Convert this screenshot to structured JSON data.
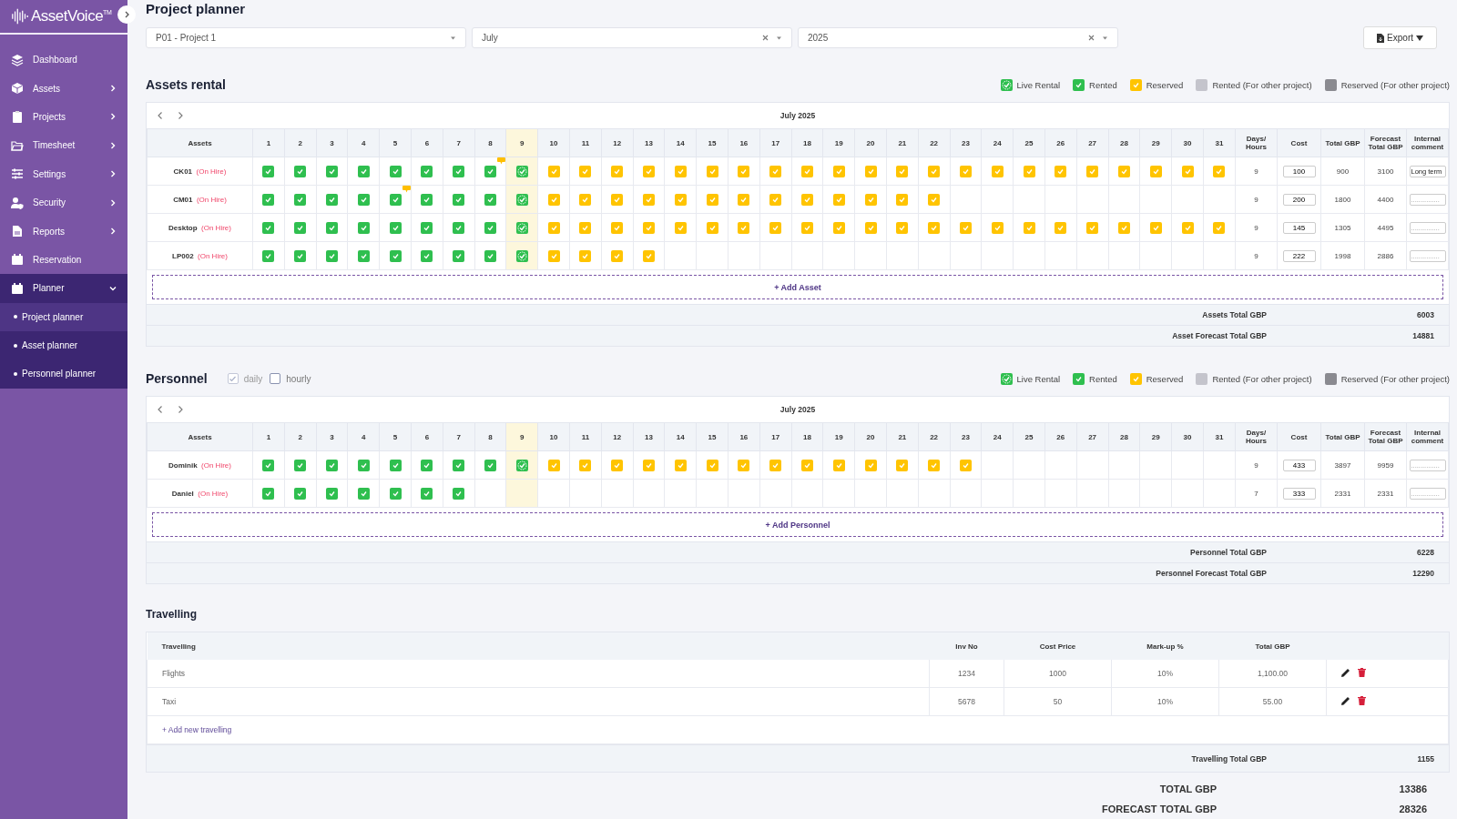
{
  "sidebar": {
    "logo": "AssetVoice",
    "logo_mark": "TM",
    "items": [
      {
        "label": "Dashboard",
        "selected": false
      },
      {
        "label": "Assets",
        "expanded": false,
        "selected": false
      },
      {
        "label": "Projects",
        "expanded": false,
        "selected": false
      },
      {
        "label": "Timesheet",
        "expanded": false,
        "selected": false
      },
      {
        "label": "Settings",
        "expanded": false,
        "selected": false
      },
      {
        "label": "Security",
        "expanded": false,
        "selected": false
      },
      {
        "label": "Reports",
        "expanded": false,
        "selected": false
      },
      {
        "label": "Reservation",
        "selected": false
      },
      {
        "label": "Planner",
        "expanded": true,
        "selected": true,
        "children": [
          {
            "label": "Project planner",
            "selected": true
          },
          {
            "label": "Asset planner",
            "selected": false
          },
          {
            "label": "Personnel planner",
            "selected": false
          }
        ]
      }
    ]
  },
  "page_title": "Project planner",
  "filters": [
    {
      "value": "P01 - Project 1",
      "clearable": false
    },
    {
      "value": "July",
      "clearable": true
    },
    {
      "value": "2025",
      "clearable": true
    }
  ],
  "export_button": "Export",
  "assets_rental": {
    "title": "Assets rental",
    "legend": [
      {
        "label": "Live Rental",
        "kind": "live"
      },
      {
        "label": "Rented",
        "kind": "rented"
      },
      {
        "label": "Reserved",
        "kind": "reserved"
      },
      {
        "label": "Rented (For other project)",
        "kind": "other_rented"
      },
      {
        "label": "Reserved (For other project)",
        "kind": "other_reserved"
      }
    ],
    "month": "July 2025",
    "first_header": "Assets",
    "days": [
      {
        "label": "1",
        "today": false
      },
      {
        "label": "2",
        "today": false
      },
      {
        "label": "3",
        "today": false
      },
      {
        "label": "4",
        "today": false
      },
      {
        "label": "5",
        "today": false
      },
      {
        "label": "6",
        "today": false
      },
      {
        "label": "7",
        "today": false
      },
      {
        "label": "8",
        "today": false
      },
      {
        "label": "9",
        "today": true
      },
      {
        "label": "10",
        "today": false
      },
      {
        "label": "11",
        "today": false
      },
      {
        "label": "12",
        "today": false
      },
      {
        "label": "13",
        "today": false
      },
      {
        "label": "14",
        "today": false
      },
      {
        "label": "15",
        "today": false
      },
      {
        "label": "16",
        "today": false
      },
      {
        "label": "17",
        "today": false
      },
      {
        "label": "18",
        "today": false
      },
      {
        "label": "19",
        "today": false
      },
      {
        "label": "20",
        "today": false
      },
      {
        "label": "21",
        "today": false
      },
      {
        "label": "22",
        "today": false
      },
      {
        "label": "23",
        "today": false
      },
      {
        "label": "24",
        "today": false
      },
      {
        "label": "25",
        "today": false
      },
      {
        "label": "26",
        "today": false
      },
      {
        "label": "27",
        "today": false
      },
      {
        "label": "28",
        "today": false
      },
      {
        "label": "29",
        "today": false
      },
      {
        "label": "30",
        "today": false
      },
      {
        "label": "31",
        "today": false
      }
    ],
    "extra_headers": [
      "Days/ Hours",
      "Cost",
      "Total GBP",
      "Forecast Total GBP",
      "Internal comment"
    ],
    "rows": [
      {
        "name": "CK01",
        "status": "(On Hire)",
        "cells": [
          {
            "kind": "rented",
            "note": false
          },
          {
            "kind": "rented",
            "note": false
          },
          {
            "kind": "rented",
            "note": false
          },
          {
            "kind": "rented",
            "note": false
          },
          {
            "kind": "rented",
            "note": false
          },
          {
            "kind": "rented",
            "note": false
          },
          {
            "kind": "rented",
            "note": false
          },
          {
            "kind": "rented",
            "note": true
          },
          {
            "kind": "live",
            "note": false
          },
          {
            "kind": "reserved",
            "note": false
          },
          {
            "kind": "reserved",
            "note": false
          },
          {
            "kind": "reserved",
            "note": false
          },
          {
            "kind": "reserved",
            "note": false
          },
          {
            "kind": "reserved",
            "note": false
          },
          {
            "kind": "reserved",
            "note": false
          },
          {
            "kind": "reserved",
            "note": false
          },
          {
            "kind": "reserved",
            "note": false
          },
          {
            "kind": "reserved",
            "note": false
          },
          {
            "kind": "reserved",
            "note": false
          },
          {
            "kind": "reserved",
            "note": false
          },
          {
            "kind": "reserved",
            "note": false
          },
          {
            "kind": "reserved",
            "note": false
          },
          {
            "kind": "reserved",
            "note": false
          },
          {
            "kind": "reserved",
            "note": false
          },
          {
            "kind": "reserved",
            "note": false
          },
          {
            "kind": "reserved",
            "note": false
          },
          {
            "kind": "reserved",
            "note": false
          },
          {
            "kind": "reserved",
            "note": false
          },
          {
            "kind": "reserved",
            "note": false
          },
          {
            "kind": "reserved",
            "note": false
          },
          {
            "kind": "reserved",
            "note": false
          }
        ],
        "days_hours": "9",
        "cost": "100",
        "total": "900",
        "forecast": "3100",
        "comment": {
          "value": "Long term"
        }
      },
      {
        "name": "CM01",
        "status": "(On Hire)",
        "cells": [
          {
            "kind": "rented",
            "note": false
          },
          {
            "kind": "rented",
            "note": false
          },
          {
            "kind": "rented",
            "note": false
          },
          {
            "kind": "rented",
            "note": false
          },
          {
            "kind": "rented",
            "note": true
          },
          {
            "kind": "rented",
            "note": false
          },
          {
            "kind": "rented",
            "note": false
          },
          {
            "kind": "rented",
            "note": false
          },
          {
            "kind": "live",
            "note": false
          },
          {
            "kind": "reserved",
            "note": false
          },
          {
            "kind": "reserved",
            "note": false
          },
          {
            "kind": "reserved",
            "note": false
          },
          {
            "kind": "reserved",
            "note": false
          },
          {
            "kind": "reserved",
            "note": false
          },
          {
            "kind": "reserved",
            "note": false
          },
          {
            "kind": "reserved",
            "note": false
          },
          {
            "kind": "reserved",
            "note": false
          },
          {
            "kind": "reserved",
            "note": false
          },
          {
            "kind": "reserved",
            "note": false
          },
          {
            "kind": "reserved",
            "note": false
          },
          {
            "kind": "reserved",
            "note": false
          },
          {
            "kind": "reserved",
            "note": false
          },
          {
            "kind": "none",
            "note": false
          },
          {
            "kind": "none",
            "note": false
          },
          {
            "kind": "none",
            "note": false
          },
          {
            "kind": "none",
            "note": false
          },
          {
            "kind": "none",
            "note": false
          },
          {
            "kind": "none",
            "note": false
          },
          {
            "kind": "none",
            "note": false
          },
          {
            "kind": "none",
            "note": false
          },
          {
            "kind": "none",
            "note": false
          }
        ],
        "days_hours": "9",
        "cost": "200",
        "total": "1800",
        "forecast": "4400",
        "comment": {
          "placeholder": "..............."
        }
      },
      {
        "name": "Desktop",
        "status": "(On Hire)",
        "cells": [
          {
            "kind": "rented",
            "note": false
          },
          {
            "kind": "rented",
            "note": false
          },
          {
            "kind": "rented",
            "note": false
          },
          {
            "kind": "rented",
            "note": false
          },
          {
            "kind": "rented",
            "note": false
          },
          {
            "kind": "rented",
            "note": false
          },
          {
            "kind": "rented",
            "note": false
          },
          {
            "kind": "rented",
            "note": false
          },
          {
            "kind": "live",
            "note": false
          },
          {
            "kind": "reserved",
            "note": false
          },
          {
            "kind": "reserved",
            "note": false
          },
          {
            "kind": "reserved",
            "note": false
          },
          {
            "kind": "reserved",
            "note": false
          },
          {
            "kind": "reserved",
            "note": false
          },
          {
            "kind": "reserved",
            "note": false
          },
          {
            "kind": "reserved",
            "note": false
          },
          {
            "kind": "reserved",
            "note": false
          },
          {
            "kind": "reserved",
            "note": false
          },
          {
            "kind": "reserved",
            "note": false
          },
          {
            "kind": "reserved",
            "note": false
          },
          {
            "kind": "reserved",
            "note": false
          },
          {
            "kind": "reserved",
            "note": false
          },
          {
            "kind": "reserved",
            "note": false
          },
          {
            "kind": "reserved",
            "note": false
          },
          {
            "kind": "reserved",
            "note": false
          },
          {
            "kind": "reserved",
            "note": false
          },
          {
            "kind": "reserved",
            "note": false
          },
          {
            "kind": "reserved",
            "note": false
          },
          {
            "kind": "reserved",
            "note": false
          },
          {
            "kind": "reserved",
            "note": false
          },
          {
            "kind": "reserved",
            "note": false
          }
        ],
        "days_hours": "9",
        "cost": "145",
        "total": "1305",
        "forecast": "4495",
        "comment": {
          "placeholder": "..............."
        }
      },
      {
        "name": "LP002",
        "status": "(On Hire)",
        "cells": [
          {
            "kind": "rented",
            "note": false
          },
          {
            "kind": "rented",
            "note": false
          },
          {
            "kind": "rented",
            "note": false
          },
          {
            "kind": "rented",
            "note": false
          },
          {
            "kind": "rented",
            "note": false
          },
          {
            "kind": "rented",
            "note": false
          },
          {
            "kind": "rented",
            "note": false
          },
          {
            "kind": "rented",
            "note": false
          },
          {
            "kind": "live",
            "note": false
          },
          {
            "kind": "reserved",
            "note": false
          },
          {
            "kind": "reserved",
            "note": false
          },
          {
            "kind": "reserved",
            "note": false
          },
          {
            "kind": "reserved",
            "note": false
          },
          {
            "kind": "none",
            "note": false
          },
          {
            "kind": "none",
            "note": false
          },
          {
            "kind": "none",
            "note": false
          },
          {
            "kind": "none",
            "note": false
          },
          {
            "kind": "none",
            "note": false
          },
          {
            "kind": "none",
            "note": false
          },
          {
            "kind": "none",
            "note": false
          },
          {
            "kind": "none",
            "note": false
          },
          {
            "kind": "none",
            "note": false
          },
          {
            "kind": "none",
            "note": false
          },
          {
            "kind": "none",
            "note": false
          },
          {
            "kind": "none",
            "note": false
          },
          {
            "kind": "none",
            "note": false
          },
          {
            "kind": "none",
            "note": false
          },
          {
            "kind": "none",
            "note": false
          },
          {
            "kind": "none",
            "note": false
          },
          {
            "kind": "none",
            "note": false
          },
          {
            "kind": "none",
            "note": false
          }
        ],
        "days_hours": "9",
        "cost": "222",
        "total": "1998",
        "forecast": "2886",
        "comment": {
          "placeholder": "..............."
        }
      }
    ],
    "add_label": "+ Add Asset",
    "totals": [
      {
        "label": "Assets Total GBP",
        "value": "6003"
      },
      {
        "label": "Asset Forecast Total GBP",
        "value": "14881"
      }
    ]
  },
  "personnel": {
    "title": "Personnel",
    "options": [
      {
        "label": "daily",
        "checked": true,
        "disabled": true
      },
      {
        "label": "hourly",
        "checked": false,
        "disabled": false
      }
    ],
    "legend": [
      {
        "label": "Live Rental",
        "kind": "live"
      },
      {
        "label": "Rented",
        "kind": "rented"
      },
      {
        "label": "Reserved",
        "kind": "reserved"
      },
      {
        "label": "Rented (For other project)",
        "kind": "other_rented"
      },
      {
        "label": "Reserved (For other project)",
        "kind": "other_reserved"
      }
    ],
    "month": "July 2025",
    "first_header": "Assets",
    "days": [
      {
        "label": "1",
        "today": false
      },
      {
        "label": "2",
        "today": false
      },
      {
        "label": "3",
        "today": false
      },
      {
        "label": "4",
        "today": false
      },
      {
        "label": "5",
        "today": false
      },
      {
        "label": "6",
        "today": false
      },
      {
        "label": "7",
        "today": false
      },
      {
        "label": "8",
        "today": false
      },
      {
        "label": "9",
        "today": true
      },
      {
        "label": "10",
        "today": false
      },
      {
        "label": "11",
        "today": false
      },
      {
        "label": "12",
        "today": false
      },
      {
        "label": "13",
        "today": false
      },
      {
        "label": "14",
        "today": false
      },
      {
        "label": "15",
        "today": false
      },
      {
        "label": "16",
        "today": false
      },
      {
        "label": "17",
        "today": false
      },
      {
        "label": "18",
        "today": false
      },
      {
        "label": "19",
        "today": false
      },
      {
        "label": "20",
        "today": false
      },
      {
        "label": "21",
        "today": false
      },
      {
        "label": "22",
        "today": false
      },
      {
        "label": "23",
        "today": false
      },
      {
        "label": "24",
        "today": false
      },
      {
        "label": "25",
        "today": false
      },
      {
        "label": "26",
        "today": false
      },
      {
        "label": "27",
        "today": false
      },
      {
        "label": "28",
        "today": false
      },
      {
        "label": "29",
        "today": false
      },
      {
        "label": "30",
        "today": false
      },
      {
        "label": "31",
        "today": false
      }
    ],
    "extra_headers": [
      "Days/ Hours",
      "Cost",
      "Total GBP",
      "Forecast Total GBP",
      "Internal comment"
    ],
    "rows": [
      {
        "name": "Dominik",
        "status": "(On Hire)",
        "cells": [
          {
            "kind": "rented",
            "note": false
          },
          {
            "kind": "rented",
            "note": false
          },
          {
            "kind": "rented",
            "note": false
          },
          {
            "kind": "rented",
            "note": false
          },
          {
            "kind": "rented",
            "note": false
          },
          {
            "kind": "rented",
            "note": false
          },
          {
            "kind": "rented",
            "note": false
          },
          {
            "kind": "rented",
            "note": false
          },
          {
            "kind": "live",
            "note": false
          },
          {
            "kind": "reserved",
            "note": false
          },
          {
            "kind": "reserved",
            "note": false
          },
          {
            "kind": "reserved",
            "note": false
          },
          {
            "kind": "reserved",
            "note": false
          },
          {
            "kind": "reserved",
            "note": false
          },
          {
            "kind": "reserved",
            "note": false
          },
          {
            "kind": "reserved",
            "note": false
          },
          {
            "kind": "reserved",
            "note": false
          },
          {
            "kind": "reserved",
            "note": false
          },
          {
            "kind": "reserved",
            "note": false
          },
          {
            "kind": "reserved",
            "note": false
          },
          {
            "kind": "reserved",
            "note": false
          },
          {
            "kind": "reserved",
            "note": false
          },
          {
            "kind": "reserved",
            "note": false
          },
          {
            "kind": "none",
            "note": false
          },
          {
            "kind": "none",
            "note": false
          },
          {
            "kind": "none",
            "note": false
          },
          {
            "kind": "none",
            "note": false
          },
          {
            "kind": "none",
            "note": false
          },
          {
            "kind": "none",
            "note": false
          },
          {
            "kind": "none",
            "note": false
          },
          {
            "kind": "none",
            "note": false
          }
        ],
        "days_hours": "9",
        "cost": "433",
        "total": "3897",
        "forecast": "9959",
        "comment": {
          "placeholder": "..............."
        }
      },
      {
        "name": "Daniel",
        "status": "(On Hire)",
        "cells": [
          {
            "kind": "rented",
            "note": false
          },
          {
            "kind": "rented",
            "note": false
          },
          {
            "kind": "rented",
            "note": false
          },
          {
            "kind": "rented",
            "note": false
          },
          {
            "kind": "rented",
            "note": false
          },
          {
            "kind": "rented",
            "note": false
          },
          {
            "kind": "rented",
            "note": false
          },
          {
            "kind": "none",
            "note": false
          },
          {
            "kind": "none",
            "note": false
          },
          {
            "kind": "none",
            "note": false
          },
          {
            "kind": "none",
            "note": false
          },
          {
            "kind": "none",
            "note": false
          },
          {
            "kind": "none",
            "note": false
          },
          {
            "kind": "none",
            "note": false
          },
          {
            "kind": "none",
            "note": false
          },
          {
            "kind": "none",
            "note": false
          },
          {
            "kind": "none",
            "note": false
          },
          {
            "kind": "none",
            "note": false
          },
          {
            "kind": "none",
            "note": false
          },
          {
            "kind": "none",
            "note": false
          },
          {
            "kind": "none",
            "note": false
          },
          {
            "kind": "none",
            "note": false
          },
          {
            "kind": "none",
            "note": false
          },
          {
            "kind": "none",
            "note": false
          },
          {
            "kind": "none",
            "note": false
          },
          {
            "kind": "none",
            "note": false
          },
          {
            "kind": "none",
            "note": false
          },
          {
            "kind": "none",
            "note": false
          },
          {
            "kind": "none",
            "note": false
          },
          {
            "kind": "none",
            "note": false
          },
          {
            "kind": "none",
            "note": false
          }
        ],
        "days_hours": "7",
        "cost": "333",
        "total": "2331",
        "forecast": "2331",
        "comment": {
          "placeholder": "..............."
        }
      }
    ],
    "add_label": "+ Add Personnel",
    "totals": [
      {
        "label": "Personnel Total GBP",
        "value": "6228"
      },
      {
        "label": "Personnel Forecast Total GBP",
        "value": "12290"
      }
    ]
  },
  "travelling": {
    "title": "Travelling",
    "columns": [
      "Travelling",
      "Inv No",
      "Cost Price",
      "Mark-up %",
      "Total GBP"
    ],
    "rows": [
      {
        "cells": [
          "Flights",
          "1234",
          "1000",
          "10%",
          "1,100.00"
        ]
      },
      {
        "cells": [
          "Taxi",
          "5678",
          "50",
          "10%",
          "55.00"
        ]
      }
    ],
    "add_label": "+ Add new travelling",
    "total": {
      "label": "Travelling Total GBP",
      "value": "1155"
    }
  },
  "grand_totals": [
    {
      "label": "TOTAL GBP",
      "value": "13386"
    },
    {
      "label": "FORECAST TOTAL GBP",
      "value": "28326"
    }
  ]
}
